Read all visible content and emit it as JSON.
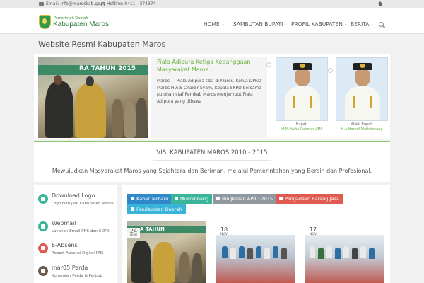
{
  "topbar": {
    "email": "Email: info@maroskab.go.id",
    "hotline": "Hotline: 0411 - 374374"
  },
  "header": {
    "logo_small": "Pemerintah Daerah",
    "logo_big": "Kabupaten Maros",
    "nav": [
      "HOME",
      "SAMBUTAN BUPATI",
      "PROFIL KABUPATEN",
      "BERITA"
    ]
  },
  "page_title": "Website Resmi Kabupaten Maros",
  "slider": {
    "banner_text": "RA TAHUN 2015",
    "title": "Piala Adipura Ketiga Kebanggaan Masyarakat Maros",
    "body": "Maros — Piala Adipura tiba di Maros. Ketua DPRD Maros H.A.S Chaidir Syam, Kepala SKPD bersama puluhan staf Pemkab Maros menjemput Piala Adipura yang dibawa"
  },
  "officials": [
    {
      "role": "Bupati",
      "name": "H.M.Hatta Rahman,MM"
    },
    {
      "role": "Wakil Bupati",
      "name": "H.A.Harmil Mattotorang"
    }
  ],
  "visi": {
    "title": "VISI KABUPATEN MAROS 2010 - 2015",
    "text": "Mewujudkan Masyarakat Maros yang Sejahtera dan Beriman, melalui Pemerintahan yang Bersih dan Profesional."
  },
  "sidebar": {
    "items": [
      {
        "title": "Download Logo",
        "sub": "Logo Hari jadi Kabupaten Maros",
        "color": "#3bb59a"
      },
      {
        "title": "Webmail",
        "sub": "Layanan Email PNS dan SKPD",
        "color": "#3bb59a"
      },
      {
        "title": "E-Absensi",
        "sub": "Report Absensi Digital PNS",
        "color": "#e05a4f"
      },
      {
        "title": "mar05 Perda",
        "sub": "Kumpulan Perda & Perbub",
        "color": "#6b5b4e"
      }
    ]
  },
  "tabs": [
    {
      "label": "Kabar Terbaru",
      "color": "#2f88c9"
    },
    {
      "label": "Musrenbang",
      "color": "#3bb59a"
    },
    {
      "label": "Ringkasan APBD 2015",
      "color": "#8f989e"
    },
    {
      "label": "Pengadaan Barang Jasa",
      "color": "#e05a4f"
    },
    {
      "label": "Pendapatan Daerah",
      "color": "#38b3d9"
    }
  ],
  "news": [
    {
      "day": "24",
      "month": "NOV",
      "banner": "A TAHUN"
    },
    {
      "day": "18",
      "month": "NOV"
    },
    {
      "day": "17",
      "month": "NOV"
    }
  ]
}
